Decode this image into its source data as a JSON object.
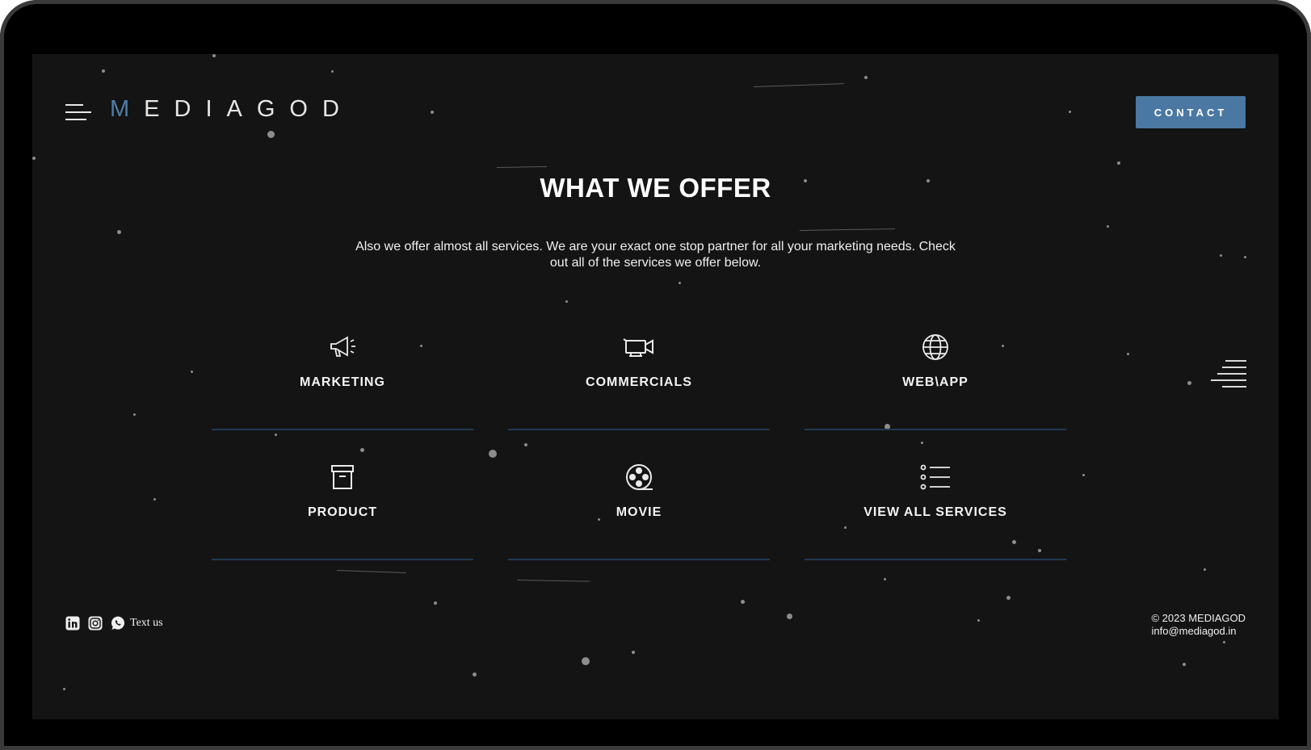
{
  "brand": {
    "logo_first": "M",
    "logo_rest": "EDIAGOD"
  },
  "header": {
    "contact_label": "CONTACT"
  },
  "section": {
    "title": "WHAT WE OFFER",
    "subtitle": "Also we offer almost all services. We are your exact one stop partner for all your marketing needs. Check out all of the services we offer below."
  },
  "services": [
    {
      "label": "MARKETING",
      "icon": "megaphone-icon"
    },
    {
      "label": "COMMERCIALS",
      "icon": "video-camera-icon"
    },
    {
      "label": "WEB\\APP",
      "icon": "globe-icon"
    },
    {
      "label": "PRODUCT",
      "icon": "archive-box-icon"
    },
    {
      "label": "MOVIE",
      "icon": "film-reel-icon"
    },
    {
      "label": "VIEW ALL SERVICES",
      "icon": "list-icon"
    }
  ],
  "footer": {
    "social": [
      "linkedin-icon",
      "instagram-icon",
      "whatsapp-icon"
    ],
    "text_us": "Text us",
    "copyright": "© 2023 MEDIAGOD",
    "email": "info@mediagod.in"
  },
  "colors": {
    "accent": "#4a78a3",
    "background": "#141414",
    "underline": "#1f3b55"
  }
}
